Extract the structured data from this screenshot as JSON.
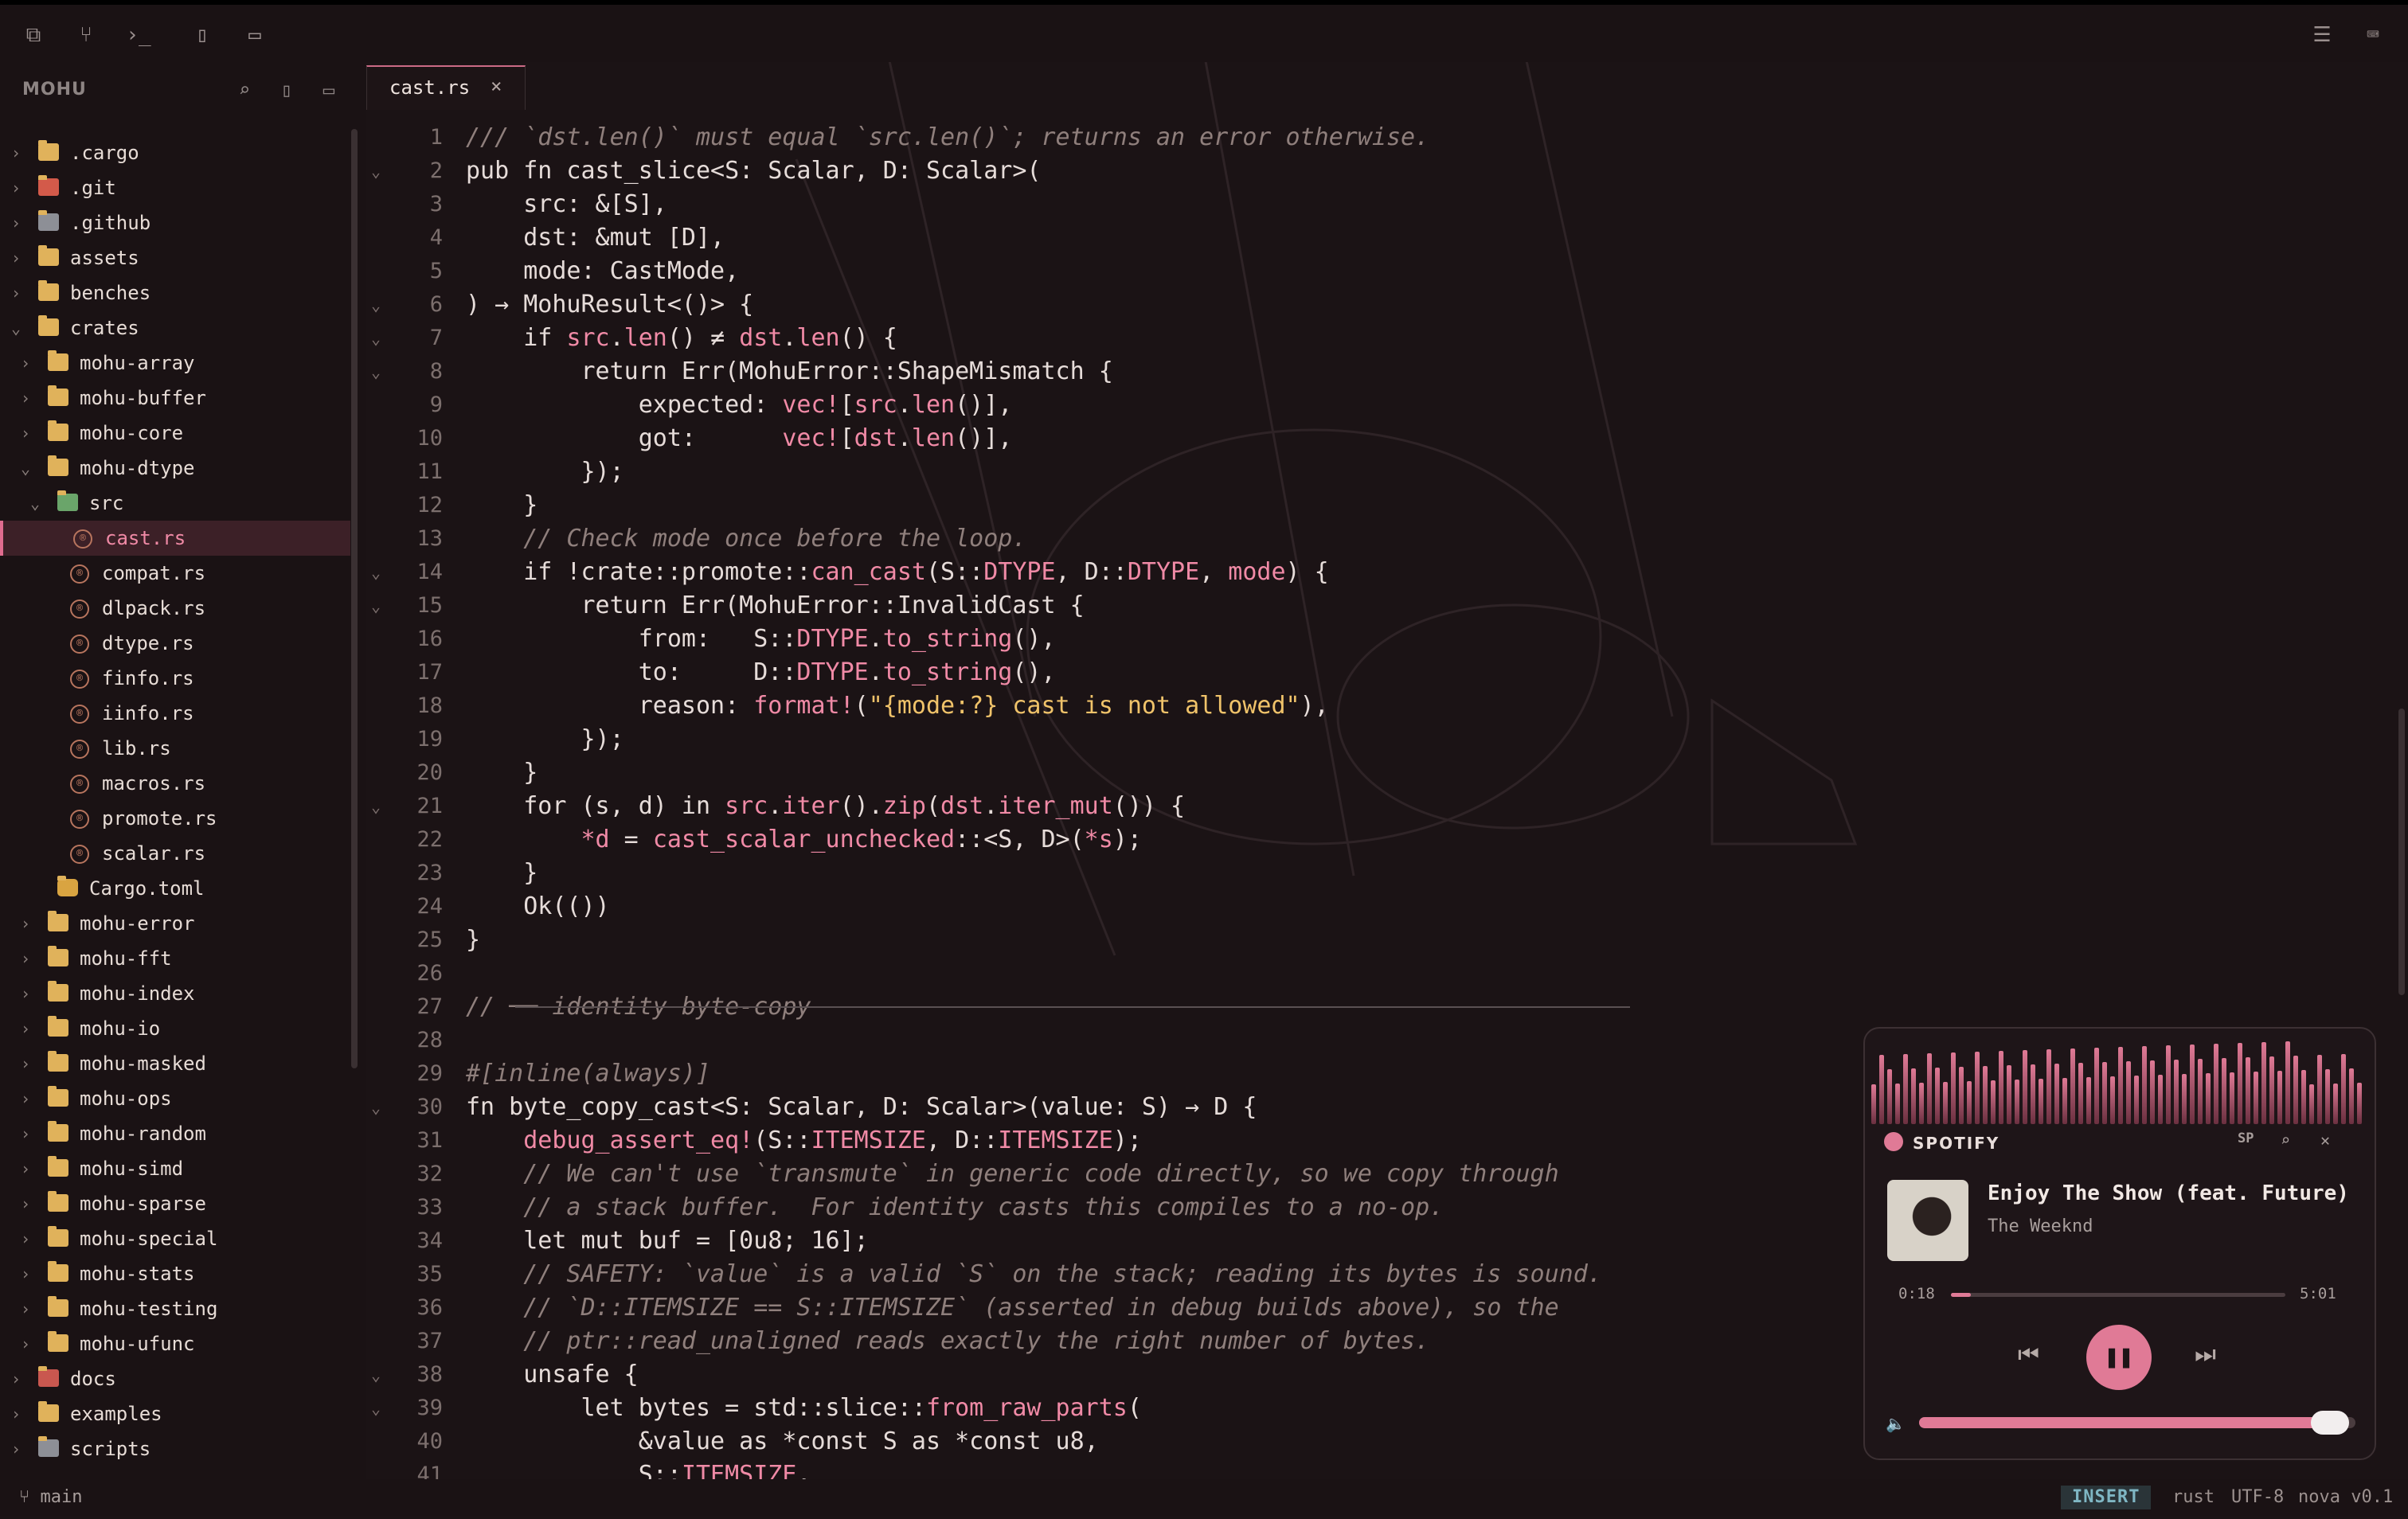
{
  "sidebar": {
    "title": "MOHU",
    "tree": [
      {
        "label": ".cargo",
        "icon": "folder-icon",
        "depth": 0,
        "chev": "›"
      },
      {
        "label": ".git",
        "icon": "git-folder-icon",
        "depth": 0,
        "chev": "›"
      },
      {
        "label": ".github",
        "icon": "github-folder-icon",
        "depth": 0,
        "chev": "›"
      },
      {
        "label": "assets",
        "icon": "folder-icon",
        "depth": 0,
        "chev": "›"
      },
      {
        "label": "benches",
        "icon": "folder-icon",
        "depth": 0,
        "chev": "›"
      },
      {
        "label": "crates",
        "icon": "folder-open-icon",
        "depth": 0,
        "chev": "⌄"
      },
      {
        "label": "mohu-array",
        "icon": "folder-icon",
        "depth": 1,
        "chev": "›"
      },
      {
        "label": "mohu-buffer",
        "icon": "folder-icon",
        "depth": 1,
        "chev": "›"
      },
      {
        "label": "mohu-core",
        "icon": "folder-icon",
        "depth": 1,
        "chev": "›"
      },
      {
        "label": "mohu-dtype",
        "icon": "folder-open-icon",
        "depth": 1,
        "chev": "⌄"
      },
      {
        "label": "src",
        "icon": "src-folder-icon",
        "depth": 2,
        "chev": "⌄"
      },
      {
        "label": "cast.rs",
        "icon": "rust-file-icon",
        "depth": 3,
        "selected": true
      },
      {
        "label": "compat.rs",
        "icon": "rust-file-icon",
        "depth": 3
      },
      {
        "label": "dlpack.rs",
        "icon": "rust-file-icon",
        "depth": 3
      },
      {
        "label": "dtype.rs",
        "icon": "rust-file-icon",
        "depth": 3
      },
      {
        "label": "finfo.rs",
        "icon": "rust-file-icon",
        "depth": 3
      },
      {
        "label": "iinfo.rs",
        "icon": "rust-file-icon",
        "depth": 3
      },
      {
        "label": "lib.rs",
        "icon": "rust-file-icon",
        "depth": 3
      },
      {
        "label": "macros.rs",
        "icon": "rust-file-icon",
        "depth": 3
      },
      {
        "label": "promote.rs",
        "icon": "rust-file-icon",
        "depth": 3
      },
      {
        "label": "scalar.rs",
        "icon": "rust-file-icon",
        "depth": 3
      },
      {
        "label": "Cargo.toml",
        "icon": "cargo-toml-icon",
        "depth": 2
      },
      {
        "label": "mohu-error",
        "icon": "folder-icon",
        "depth": 1,
        "chev": "›"
      },
      {
        "label": "mohu-fft",
        "icon": "folder-icon",
        "depth": 1,
        "chev": "›"
      },
      {
        "label": "mohu-index",
        "icon": "folder-icon",
        "depth": 1,
        "chev": "›"
      },
      {
        "label": "mohu-io",
        "icon": "folder-icon",
        "depth": 1,
        "chev": "›"
      },
      {
        "label": "mohu-masked",
        "icon": "folder-icon",
        "depth": 1,
        "chev": "›"
      },
      {
        "label": "mohu-ops",
        "icon": "folder-icon",
        "depth": 1,
        "chev": "›"
      },
      {
        "label": "mohu-random",
        "icon": "folder-icon",
        "depth": 1,
        "chev": "›"
      },
      {
        "label": "mohu-simd",
        "icon": "folder-icon",
        "depth": 1,
        "chev": "›"
      },
      {
        "label": "mohu-sparse",
        "icon": "folder-icon",
        "depth": 1,
        "chev": "›"
      },
      {
        "label": "mohu-special",
        "icon": "folder-icon",
        "depth": 1,
        "chev": "›"
      },
      {
        "label": "mohu-stats",
        "icon": "folder-icon",
        "depth": 1,
        "chev": "›"
      },
      {
        "label": "mohu-testing",
        "icon": "folder-icon",
        "depth": 1,
        "chev": "›"
      },
      {
        "label": "mohu-ufunc",
        "icon": "folder-icon",
        "depth": 1,
        "chev": "›"
      },
      {
        "label": "docs",
        "icon": "docs-folder-icon",
        "depth": 0,
        "chev": "›"
      },
      {
        "label": "examples",
        "icon": "folder-icon",
        "depth": 0,
        "chev": "›"
      },
      {
        "label": "scripts",
        "icon": "scripts-folder-icon",
        "depth": 0,
        "chev": "›"
      }
    ]
  },
  "tab": {
    "label": "cast.rs",
    "close": "×"
  },
  "editor": {
    "lines": [
      {
        "n": "1",
        "fold": false,
        "html": "<span class=\"c\">/// `dst.len()` must equal `src.len()`; returns an error otherwise.</span>"
      },
      {
        "n": "2",
        "fold": true,
        "html": "pub fn cast_slice&lt;S: Scalar, D: Scalar&gt;("
      },
      {
        "n": "3",
        "fold": false,
        "html": "    src: &amp;[S],"
      },
      {
        "n": "4",
        "fold": false,
        "html": "    dst: &amp;mut [D],"
      },
      {
        "n": "5",
        "fold": false,
        "html": "    mode: CastMode,"
      },
      {
        "n": "6",
        "fold": true,
        "html": ") → MohuResult&lt;()&gt; {"
      },
      {
        "n": "7",
        "fold": true,
        "html": "    if <span class=\"m\">src</span>.<span class=\"m\">len</span>() ≠ <span class=\"m\">dst</span>.<span class=\"m\">len</span>() {"
      },
      {
        "n": "8",
        "fold": true,
        "html": "        return Err(MohuError::ShapeMismatch {"
      },
      {
        "n": "9",
        "fold": false,
        "html": "            expected: <span class=\"m\">vec!</span>[<span class=\"m\">src</span>.<span class=\"m\">len</span>()],"
      },
      {
        "n": "10",
        "fold": false,
        "html": "            got:      <span class=\"m\">vec!</span>[<span class=\"m\">dst</span>.<span class=\"m\">len</span>()],"
      },
      {
        "n": "11",
        "fold": false,
        "html": "        });"
      },
      {
        "n": "12",
        "fold": false,
        "html": "    }"
      },
      {
        "n": "13",
        "fold": false,
        "html": "    <span class=\"c\">// Check mode once before the loop.</span>"
      },
      {
        "n": "14",
        "fold": true,
        "html": "    if !crate::promote::<span class=\"m\">can_cast</span>(S::<span class=\"m\">DTYPE</span>, D::<span class=\"m\">DTYPE</span>, <span class=\"m\">mode</span>) {"
      },
      {
        "n": "15",
        "fold": true,
        "html": "        return Err(MohuError::InvalidCast {"
      },
      {
        "n": "16",
        "fold": false,
        "html": "            from:   S::<span class=\"m\">DTYPE</span>.<span class=\"m\">to_string</span>(),"
      },
      {
        "n": "17",
        "fold": false,
        "html": "            to:     D::<span class=\"m\">DTYPE</span>.<span class=\"m\">to_string</span>(),"
      },
      {
        "n": "18",
        "fold": false,
        "html": "            reason: <span class=\"m\">format!</span>(<span class=\"s\">\"{mode:?} cast is not allowed\"</span>),"
      },
      {
        "n": "19",
        "fold": false,
        "html": "        });"
      },
      {
        "n": "20",
        "fold": false,
        "html": "    }"
      },
      {
        "n": "21",
        "fold": true,
        "html": "    for (s, d) in <span class=\"m\">src</span>.<span class=\"m\">iter</span>().<span class=\"m\">zip</span>(<span class=\"m\">dst</span>.<span class=\"m\">iter_mut</span>()) {"
      },
      {
        "n": "22",
        "fold": false,
        "html": "        <span class=\"m\">*d</span> = <span class=\"m\">cast_scalar_unchecked</span>::&lt;S, D&gt;(<span class=\"m\">*s</span>);"
      },
      {
        "n": "23",
        "fold": false,
        "html": "    }"
      },
      {
        "n": "24",
        "fold": false,
        "html": "    Ok(())"
      },
      {
        "n": "25",
        "fold": false,
        "html": "}"
      },
      {
        "n": "26",
        "fold": false,
        "html": ""
      },
      {
        "n": "27",
        "fold": false,
        "html": "<span class=\"c\">// ── identity byte-copy</span>"
      },
      {
        "n": "28",
        "fold": false,
        "html": ""
      },
      {
        "n": "29",
        "fold": false,
        "html": "<span class=\"c\">#[inline(always)]</span>"
      },
      {
        "n": "30",
        "fold": true,
        "html": "fn byte_copy_cast&lt;S: Scalar, D: Scalar&gt;(value: S) → D {"
      },
      {
        "n": "31",
        "fold": false,
        "html": "    <span class=\"m\">debug_assert_eq!</span>(S::<span class=\"m\">ITEMSIZE</span>, D::<span class=\"m\">ITEMSIZE</span>);"
      },
      {
        "n": "32",
        "fold": false,
        "html": "    <span class=\"c\">// We can't use `transmute` in generic code directly, so we copy through</span>"
      },
      {
        "n": "33",
        "fold": false,
        "html": "    <span class=\"c\">// a stack buffer.  For identity casts this compiles to a no-op.</span>"
      },
      {
        "n": "34",
        "fold": false,
        "html": "    let mut buf = [0u8; 16];"
      },
      {
        "n": "35",
        "fold": false,
        "html": "    <span class=\"c\">// SAFETY: `value` is a valid `S` on the stack; reading its bytes is sound.</span>"
      },
      {
        "n": "36",
        "fold": false,
        "html": "    <span class=\"c\">// `D::ITEMSIZE == S::ITEMSIZE` (asserted in debug builds above), so the</span>"
      },
      {
        "n": "37",
        "fold": false,
        "html": "    <span class=\"c\">// ptr::read_unaligned reads exactly the right number of bytes.</span>"
      },
      {
        "n": "38",
        "fold": true,
        "html": "    unsafe {"
      },
      {
        "n": "39",
        "fold": true,
        "html": "        let bytes = std::slice::<span class=\"m\">from_raw_parts</span>("
      },
      {
        "n": "40",
        "fold": false,
        "html": "            &amp;value as *const S as *const u8,"
      },
      {
        "n": "41",
        "fold": false,
        "html": "            S::<span class=\"m\">ITEMSIZE</span>,"
      }
    ]
  },
  "status": {
    "branch": "main",
    "mode": "INSERT",
    "lang": "rust",
    "encoding": "UTF-8",
    "app": "nova v0.1"
  },
  "player": {
    "brand": "SPOTIFY",
    "sp": "SP",
    "title": "Enjoy The Show (feat. Future)",
    "artist": "The Weeknd",
    "elapsed": "0:18",
    "total": "5:01",
    "progress": 0.06,
    "volume": 0.97,
    "accent": "#e07a96"
  }
}
